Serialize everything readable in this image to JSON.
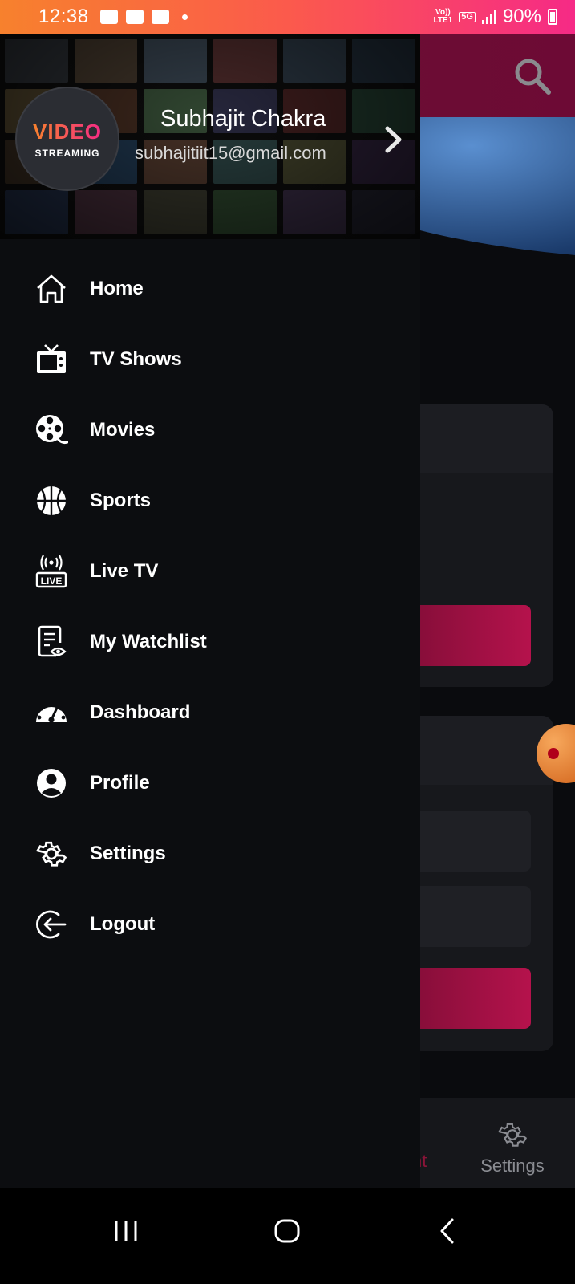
{
  "status_bar": {
    "time": "12:38",
    "network_top": "Vo))",
    "network_bottom": "LTE1",
    "network_gen": "5G",
    "battery": "90%"
  },
  "drawer": {
    "logo_line1": "VIDEO",
    "logo_line2": "STREAMING",
    "user_name": "Subhajit Chakra",
    "user_email": "subhajitiit15@gmail.com",
    "items": [
      {
        "label": "Home",
        "icon": "home-icon"
      },
      {
        "label": "TV Shows",
        "icon": "tv-icon"
      },
      {
        "label": "Movies",
        "icon": "film-reel-icon"
      },
      {
        "label": "Sports",
        "icon": "basketball-icon"
      },
      {
        "label": "Live TV",
        "icon": "live-tv-icon"
      },
      {
        "label": "My Watchlist",
        "icon": "watchlist-icon"
      },
      {
        "label": "Dashboard",
        "icon": "dashboard-icon"
      },
      {
        "label": "Profile",
        "icon": "profile-icon"
      },
      {
        "label": "Settings",
        "icon": "gear-icon"
      },
      {
        "label": "Logout",
        "icon": "logout-icon"
      }
    ]
  },
  "background_app": {
    "bottom_nav_partial": "nt",
    "bottom_nav_settings": "Settings"
  },
  "colors": {
    "accent_orange": "#f7812d",
    "accent_pink": "#f62a86",
    "drawer_bg": "#0c0d10"
  }
}
